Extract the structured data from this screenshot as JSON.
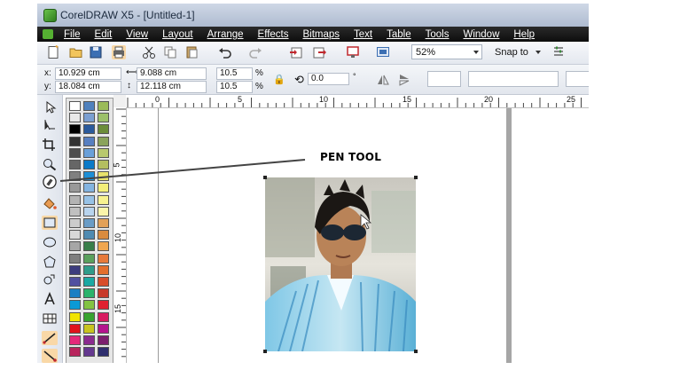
{
  "window": {
    "title": "CorelDRAW X5 - [Untitled-1]"
  },
  "menu": [
    {
      "label": "File"
    },
    {
      "label": "Edit"
    },
    {
      "label": "View"
    },
    {
      "label": "Layout"
    },
    {
      "label": "Arrange"
    },
    {
      "label": "Effects"
    },
    {
      "label": "Bitmaps"
    },
    {
      "label": "Text"
    },
    {
      "label": "Table"
    },
    {
      "label": "Tools"
    },
    {
      "label": "Window"
    },
    {
      "label": "Help"
    }
  ],
  "standard_toolbar": {
    "zoom_level": "52%",
    "snap_label": "Snap to"
  },
  "property_bar": {
    "x_label": "x:",
    "x_value": "10.929 cm",
    "y_label": "y:",
    "y_value": "18.084 cm",
    "width_value": "9.088 cm",
    "height_value": "12.118 cm",
    "scale_x": "10.5",
    "scale_y": "10.5",
    "percent_x": "%",
    "percent_y": "%",
    "rotation": "0.0"
  },
  "ruler": {
    "top_labels": [
      "0",
      "5",
      "10",
      "15",
      "20",
      "25"
    ],
    "left_labels": [
      "5",
      "10",
      "15"
    ]
  },
  "annotation": {
    "text": "PEN TOOL"
  },
  "colors": {
    "menubar": "#111111",
    "tool_highlight": "#f9d8a7",
    "accent_green": "#55b032"
  },
  "toolbox": [
    {
      "icon": "pick-tool-icon"
    },
    {
      "icon": "shape-tool-icon"
    },
    {
      "icon": "crop-tool-icon"
    },
    {
      "icon": "zoom-tool-icon"
    },
    {
      "icon": "pen-tool-icon"
    },
    {
      "icon": "smart-fill-icon"
    },
    {
      "icon": "rectangle-tool-icon"
    },
    {
      "icon": "ellipse-tool-icon"
    },
    {
      "icon": "polygon-tool-icon"
    },
    {
      "icon": "basic-shapes-icon"
    },
    {
      "icon": "text-tool-icon"
    },
    {
      "icon": "table-tool-icon"
    },
    {
      "icon": "dimension-tool-icon"
    },
    {
      "icon": "connector-tool-icon"
    }
  ],
  "palette": [
    [
      "#ffffff",
      "#4f81bd",
      "#9bbb59"
    ],
    [
      "#e8e8e8",
      "#7b9fd1",
      "#9cc06a"
    ],
    [
      "#000000",
      "#2a5a9c",
      "#6c8d3a"
    ],
    [
      "#333333",
      "#577fc1",
      "#8aa35b"
    ],
    [
      "#4d4d4d",
      "#6aa0d9",
      "#b8c86e"
    ],
    [
      "#666666",
      "#0b7ac8",
      "#b4be60"
    ],
    [
      "#808080",
      "#1d8fd6",
      "#e8e26b"
    ],
    [
      "#999999",
      "#84b4e0",
      "#f2ee79"
    ],
    [
      "#b3b3b3",
      "#97c2e6",
      "#f7f290"
    ],
    [
      "#c0c0c0",
      "#b8d4ee",
      "#fbf5aa"
    ],
    [
      "#cccccc",
      "#6a9cc6",
      "#e2a159"
    ],
    [
      "#d9d9d9",
      "#4f8bb2",
      "#d98b3e"
    ],
    [
      "#a6a6a6",
      "#397e4a",
      "#f0a64f"
    ],
    [
      "#7f7f7f",
      "#5aa05d",
      "#e77a3a"
    ],
    [
      "#3c3c7e",
      "#2f9c8a",
      "#e36e2c"
    ],
    [
      "#5050a0",
      "#1ba9a3",
      "#d84d2a"
    ],
    [
      "#1a7fc3",
      "#2bb36b",
      "#c73a2a"
    ],
    [
      "#0a9ad6",
      "#83c341",
      "#e02030"
    ],
    [
      "#f1e400",
      "#38a32f",
      "#d81b60"
    ],
    [
      "#e0141c",
      "#c8c41f",
      "#b5148e"
    ],
    [
      "#e4297a",
      "#8a2b8f",
      "#7b1f6e"
    ],
    [
      "#b8245c",
      "#64388f",
      "#2e2e6e"
    ]
  ]
}
